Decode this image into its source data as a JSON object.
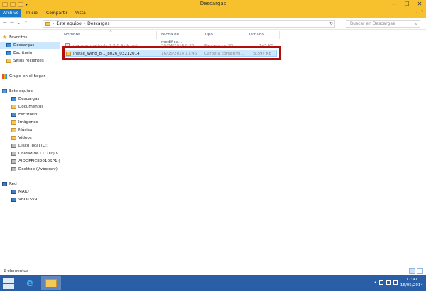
{
  "window": {
    "title": "Descargas",
    "controls": {
      "minimize": "—",
      "maximize": "☐",
      "close": "✕"
    }
  },
  "ribbon": {
    "tabs": [
      {
        "label": "Archivo",
        "active": true
      },
      {
        "label": "Inicio",
        "active": false
      },
      {
        "label": "Compartir",
        "active": false
      },
      {
        "label": "Vista",
        "active": false
      }
    ],
    "right": {
      "expand": "⌄",
      "help": "?"
    }
  },
  "address": {
    "path": [
      "Este equipo",
      "Descargas"
    ],
    "back": "←",
    "forward": "→",
    "recent": "⌄",
    "up": "↑",
    "refresh": "↻",
    "search_placeholder": "Buscar en Descargas",
    "search_icon": "search-icon"
  },
  "nav": {
    "favorites_header": "Favoritos",
    "favorites": [
      "Descargas",
      "Escritorio",
      "Sitios recientes"
    ],
    "homegroup": "Grupo en el hogar",
    "computer_header": "Este equipo",
    "computer": [
      "Descargas",
      "Documentos",
      "Escritorio",
      "Imágenes",
      "Música",
      "Vídeos",
      "Disco local (C:)",
      "Unidad de CD (D:) V",
      "AIOOFFICE2010SP1 (",
      "Desktop (\\\\vboxsrv)"
    ],
    "network_header": "Red",
    "network": [
      "MAJO",
      "VBOXSVR"
    ]
  },
  "columns": [
    "Nombre",
    "Fecha de modifica...",
    "Tipo",
    "Tamaño"
  ],
  "files": [
    {
      "name": "jmanslamnattools_2.8.0.4 dk.msi",
      "date": "30/04/2014 8:25",
      "type": "Paquete de Wi...",
      "size": "145 KB"
    },
    {
      "name": "Install_Win8_8.1_8026_03212014",
      "date": "16/05/2014 17:46",
      "type": "Carpeta comprimi...",
      "size": "5.897 KB"
    }
  ],
  "status": {
    "items": "2 elementos"
  },
  "taskbar": {
    "time": "17:47",
    "date": "16/05/2014"
  },
  "accent": "#f6c12d",
  "highlight_color": "#b40d0d"
}
